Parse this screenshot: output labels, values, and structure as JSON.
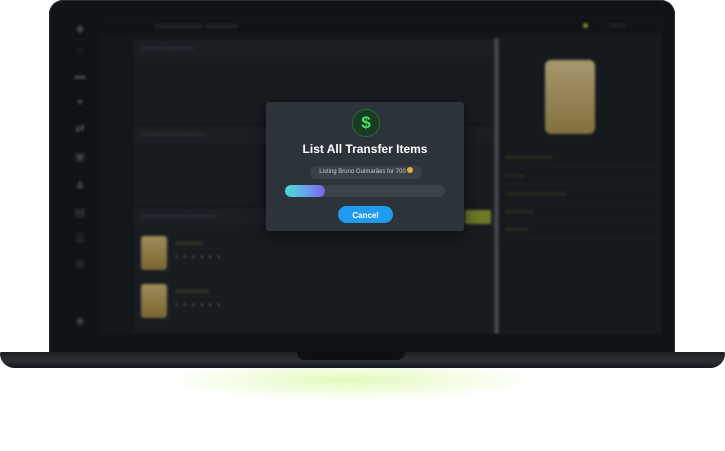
{
  "modal": {
    "icon": "$",
    "title": "List All Transfer Items",
    "status_text": "Listing Bruno Guimarães for 700",
    "progress": 0.25,
    "cancel_label": "Cancel"
  },
  "icons": {
    "status": "dollar-icon",
    "currency": "coin-icon"
  },
  "colors": {
    "accent": "#1f9bf0",
    "success": "#3fe06a",
    "progress_start": "#46e0d0",
    "progress_end": "#7b62e8",
    "highlight": "#b5c43b"
  }
}
